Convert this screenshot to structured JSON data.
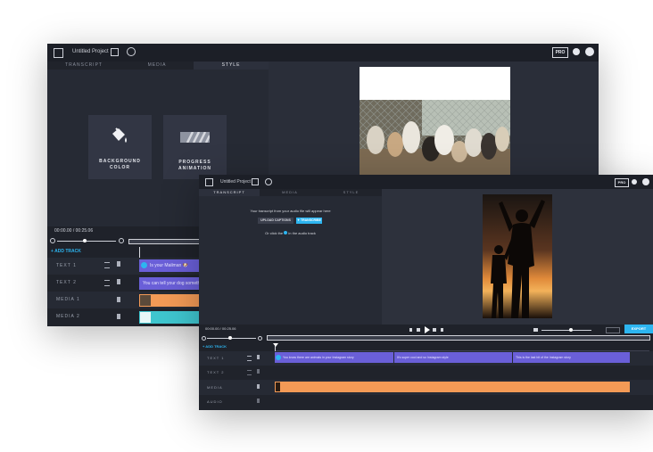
{
  "back_window": {
    "project_title": "Untitled Project",
    "pro_badge": "PRO",
    "tabs": [
      "TRANSCRIPT",
      "MEDIA",
      "STYLE"
    ],
    "cards": [
      {
        "line1": "BACKGROUND",
        "line2": "COLOR",
        "icon": "paint-bucket-icon"
      },
      {
        "line1": "PROGRESS",
        "line2": "ANIMATION",
        "icon": "progress-stripes-icon"
      }
    ],
    "timecode": "00:00.00 / 00:25.06",
    "add_track": "+ ADD TRACK",
    "tracks": [
      "TEXT 1",
      "TEXT 2",
      "MEDIA 1",
      "MEDIA 2"
    ],
    "clips": [
      "Is your Mailman 🐶",
      "You can tell your dog something and it c"
    ],
    "preview": "dogs-behind-fence-photo"
  },
  "front_window": {
    "project_title": "Untitled Project",
    "pro_badge": "PRO",
    "tabs": [
      "TRANSCRIPT",
      "MEDIA",
      "STYLE"
    ],
    "transcript_message": "Your transcript from your audio file will appear here",
    "upload_button": "UPLOAD CAPTIONS",
    "transcribe_button": "✦ TRANSCRIBE",
    "or_text": "Or click the",
    "or_text_end": "in the audio track",
    "timecode": "00:00.00 / 00:25.06",
    "add_track": "+ ADD TRACK",
    "tracks": [
      "TEXT 1",
      "TEXT 2",
      "MEDIA",
      "AUDIO"
    ],
    "clips": [
      "You know there are animals in your Instagram story",
      "It's super cool and so Instagram style",
      "This is the last bit of the Instagram story"
    ],
    "export": "EXPORT",
    "preview": "silhouette-sunset-photo",
    "colors": {
      "accent": "#2db5f0",
      "text_clip": "#6a5fd8",
      "media_clip": "#f39a56",
      "teal_clip": "#3fc6cf"
    }
  }
}
